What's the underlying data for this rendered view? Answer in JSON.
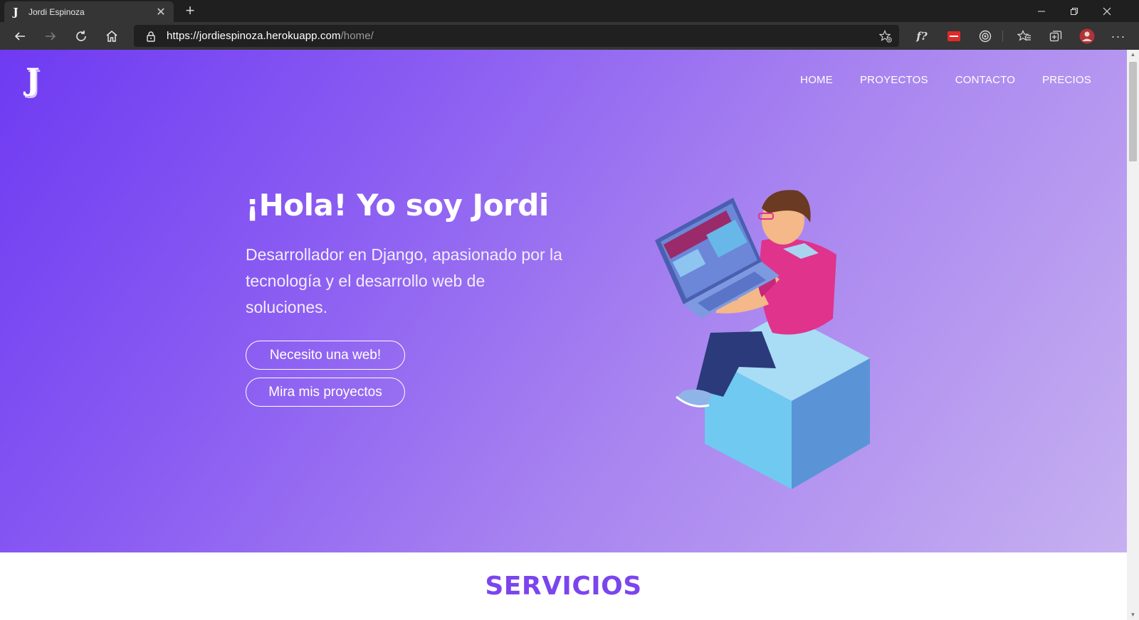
{
  "browser": {
    "tab_title": "Jordi Espinoza",
    "tab_favicon": "J",
    "url_prefix": "https://",
    "url_host": "jordiespinoza.herokuapp.com",
    "url_path": "/home/",
    "extension_labels": {
      "formula": "f?"
    }
  },
  "site": {
    "logo": "J",
    "nav": [
      "HOME",
      "PROYECTOS",
      "CONTACTO",
      "PRECIOS"
    ],
    "hero": {
      "title": "¡Hola! Yo soy Jordi",
      "text": "Desarrollador en Django, apasionado por la tecnología y el desarrollo web de soluciones.",
      "button_primary": "Necesito una web!",
      "button_secondary": "Mira mis proyectos"
    },
    "services_title": "SERVICIOS"
  },
  "colors": {
    "accent": "#7b45ee",
    "hero_start": "#6f3af2",
    "hero_end": "#c6b0f0"
  }
}
